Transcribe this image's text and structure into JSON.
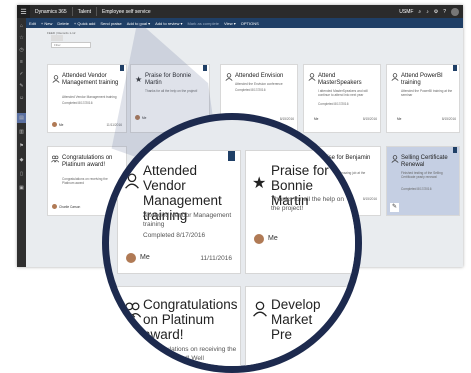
{
  "topbar": {
    "app_name": "Dynamics 365",
    "module": "Talent",
    "area": "Employee self service",
    "user": "USMF",
    "menu_icon": "waffle-icon"
  },
  "commands": [
    {
      "label": "Edit"
    },
    {
      "label": "+ New"
    },
    {
      "label": "Delete"
    },
    {
      "label": "+ Quick add"
    },
    {
      "label": "Send praise"
    },
    {
      "label": "Add to goal ▾"
    },
    {
      "label": "Add to review ▾"
    },
    {
      "label": "Mark as complete"
    },
    {
      "label": "View ▾"
    },
    {
      "label": "OPTIONS"
    }
  ],
  "breadcrumb": "FEED | Records 1-12",
  "filter": {
    "placeholder": "Filter"
  },
  "cards": [
    {
      "title": "Attended Vendor Management training",
      "desc": "Attended Vendor Management training",
      "completed": "Completed 8/17/2016",
      "owner": "Me",
      "date": "11/11/2016"
    },
    {
      "title": "Praise for Bonnie Martin",
      "desc": "Thanks for all the help on the project!",
      "completed": "",
      "owner": "Me",
      "date": ""
    },
    {
      "title": "Attended Envision",
      "desc": "Attended the Envision conference",
      "completed": "Completed 8/17/2016",
      "owner": "Me",
      "date": "8/15/2016"
    },
    {
      "title": "Attend MasterSpeakers",
      "desc": "I attended MasterSpeakers and will continue to attend into next year",
      "completed": "Completed 8/17/2016",
      "owner": "Me",
      "date": "8/15/2016"
    },
    {
      "title": "Attend PowerBI training",
      "desc": "Attended the PowerBI training at the seminar",
      "completed": "",
      "owner": "Me",
      "date": "8/15/2016"
    },
    {
      "title": "Congratulations on Platinum award!",
      "desc": "Congratulations on receiving the Platinum award",
      "completed": "",
      "owner": "Charlie Carson",
      "date": ""
    },
    {
      "title": "Praise for Benjamin Martin",
      "desc": "Thanks for the amazing job at the conference",
      "completed": "",
      "owner": "Me",
      "date": "8/15/2016"
    },
    {
      "title": "Selling Certificate Renewal",
      "desc": "Finished testing of the Selling Certificate yearly renewal",
      "completed": "Completed 8/17/2016",
      "owner": "",
      "date": ""
    }
  ],
  "lens": {
    "card1": {
      "title": "Attended Vendor Management training",
      "desc": "Attended Vendor Management training",
      "completed": "Completed 8/17/2016",
      "owner": "Me",
      "date": "11/11/2016"
    },
    "card2": {
      "title": "Praise for Bonnie Martin",
      "desc": "Thanks for all the help on the project!",
      "owner": "Me"
    },
    "card3": {
      "title": "Congratulations on Platinum award!",
      "desc": "Congratulations on receiving the Platinum award! Well"
    },
    "card4": {
      "title": "Develop Market Pre"
    }
  },
  "colors": {
    "accent": "#1f3f66",
    "lens_ring": "#1d2a4e",
    "topbar": "#2b2b2b"
  }
}
